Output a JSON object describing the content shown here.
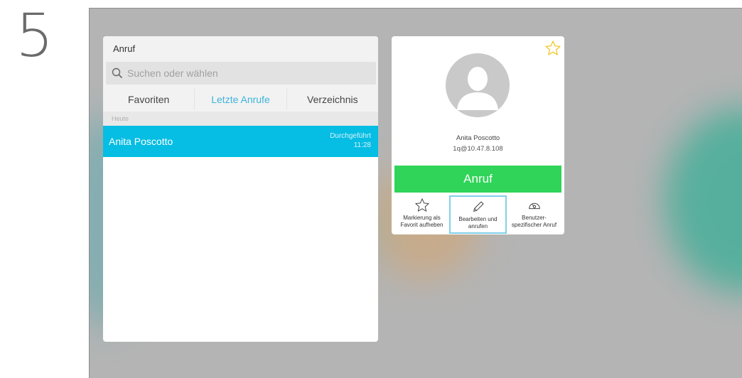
{
  "step": "5",
  "call_panel": {
    "title": "Anruf",
    "search_placeholder": "Suchen oder wählen",
    "tabs": [
      {
        "label": "Favoriten",
        "active": false
      },
      {
        "label": "Letzte Anrufe",
        "active": true
      },
      {
        "label": "Verzeichnis",
        "active": false
      }
    ],
    "section_label": "Heute",
    "recent_calls": [
      {
        "name": "Anita Poscotto",
        "status": "Durchgeführt",
        "time": "11:28"
      }
    ]
  },
  "contact_card": {
    "favorite_icon": "star-outline-icon",
    "avatar_icon": "person-silhouette-icon",
    "name": "Anita Poscotto",
    "address": "1q@10.47.8.108",
    "call_button_label": "Anruf",
    "actions": [
      {
        "icon": "star-outline-icon",
        "line1": "Markierung als",
        "line2": "Favorit aufheben"
      },
      {
        "icon": "pencil-icon",
        "line1": "Bearbeiten und",
        "line2": "anrufen"
      },
      {
        "icon": "custom-call-icon",
        "line1": "Benutzer-",
        "line2": "spezifischer Anruf"
      }
    ]
  },
  "colors": {
    "accent_blue": "#06bde3",
    "active_tab": "#3db3db",
    "call_green": "#2fd458",
    "favorite_star": "#f0c419",
    "selection_border": "#7fd0ea"
  }
}
